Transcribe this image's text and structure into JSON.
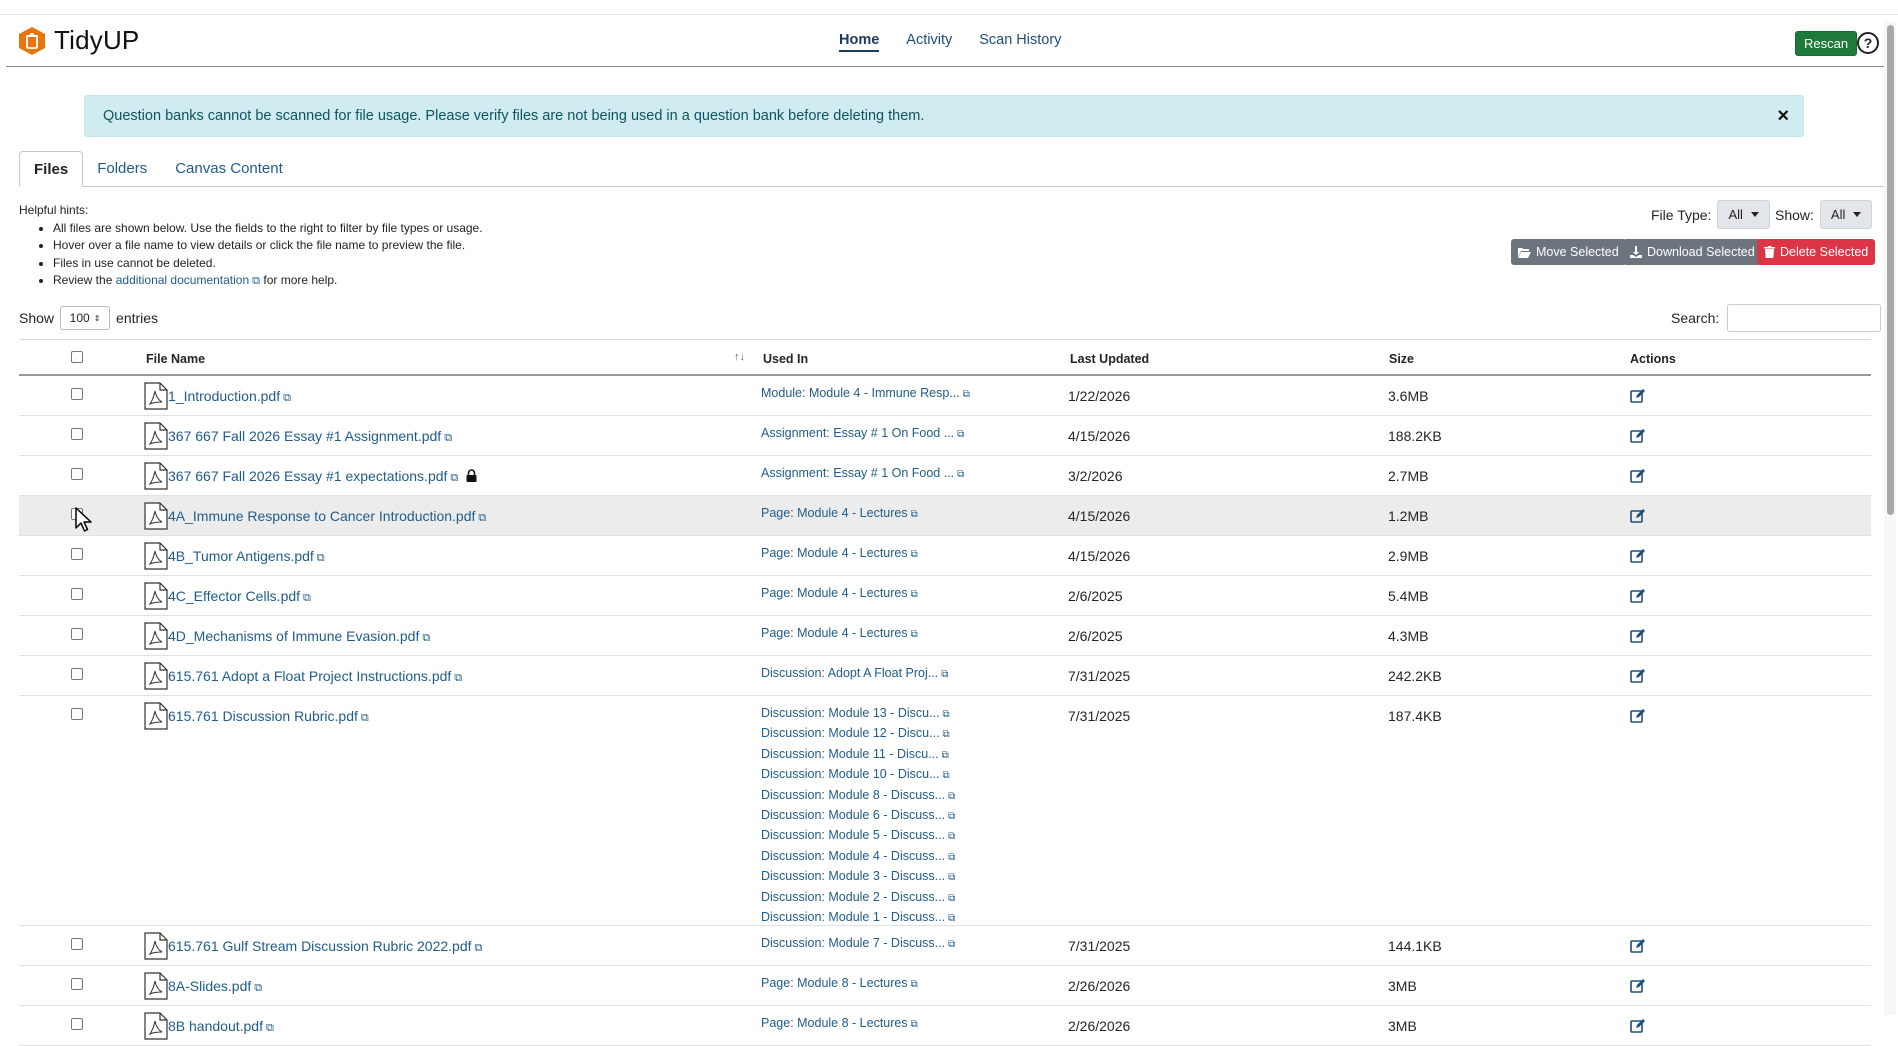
{
  "app": {
    "name": "TidyUP"
  },
  "nav": {
    "links": [
      "Home",
      "Activity",
      "Scan History"
    ],
    "active": "Home"
  },
  "header": {
    "rescan_label": "Rescan",
    "help_glyph": "?"
  },
  "alert": {
    "message": "Question banks cannot be scanned for file usage. Please verify files are not being used in a question bank before deleting them.",
    "close_glyph": "×"
  },
  "tabs": [
    "Files",
    "Folders",
    "Canvas Content"
  ],
  "hints": {
    "title": "Helpful hints:",
    "items": [
      "All files are shown below. Use the fields to the right to filter by file types or usage.",
      "Hover over a file name to view details or click the file name to preview the file.",
      "Files in use cannot be deleted."
    ],
    "review_prefix": "Review the",
    "review_link": "additional documentation",
    "review_suffix": "for more help."
  },
  "filters": {
    "file_type_label": "File Type:",
    "file_type_value": "All",
    "show_label": "Show:",
    "show_value": "All"
  },
  "actions": {
    "move": "Move Selected",
    "download": "Download Selected",
    "delete": "Delete Selected"
  },
  "entries": {
    "show_label": "Show",
    "value": "100",
    "suffix": "entries"
  },
  "search": {
    "label": "Search:",
    "value": ""
  },
  "table": {
    "headers": [
      "File Name",
      "Used In",
      "Last Updated",
      "Size",
      "Actions"
    ],
    "sort_glyph": "↑↓",
    "rows": [
      {
        "name": "1_Introduction.pdf",
        "used": [
          "Module: Module 4 - Immune Resp..."
        ],
        "date": "1/22/2026",
        "size": "3.6MB",
        "locked": false
      },
      {
        "name": "367 667 Fall 2026 Essay #1 Assignment.pdf",
        "used": [
          "Assignment: Essay # 1 On Food ..."
        ],
        "date": "4/15/2026",
        "size": "188.2KB",
        "locked": false
      },
      {
        "name": "367 667 Fall 2026 Essay #1 expectations.pdf",
        "used": [
          "Assignment: Essay # 1 On Food ..."
        ],
        "date": "3/2/2026",
        "size": "2.7MB",
        "locked": true
      },
      {
        "name": "4A_Immune Response to Cancer Introduction.pdf",
        "used": [
          "Page: Module 4 - Lectures"
        ],
        "date": "4/15/2026",
        "size": "1.2MB",
        "locked": false
      },
      {
        "name": "4B_Tumor Antigens.pdf",
        "used": [
          "Page: Module 4 - Lectures"
        ],
        "date": "4/15/2026",
        "size": "2.9MB",
        "locked": false
      },
      {
        "name": "4C_Effector Cells.pdf",
        "used": [
          "Page: Module 4 - Lectures"
        ],
        "date": "2/6/2025",
        "size": "5.4MB",
        "locked": false
      },
      {
        "name": "4D_Mechanisms of Immune Evasion.pdf",
        "used": [
          "Page: Module 4 - Lectures"
        ],
        "date": "2/6/2025",
        "size": "4.3MB",
        "locked": false
      },
      {
        "name": "615.761 Adopt a Float Project Instructions.pdf",
        "used": [
          "Discussion: Adopt A Float Proj..."
        ],
        "date": "7/31/2025",
        "size": "242.2KB",
        "locked": false
      },
      {
        "name": "615.761 Discussion Rubric.pdf",
        "used": [
          "Discussion: Module 13 - Discu...",
          "Discussion: Module 12 - Discu...",
          "Discussion: Module 11 - Discu...",
          "Discussion: Module 10 - Discu...",
          "Discussion: Module 8 - Discuss...",
          "Discussion: Module 6 - Discuss...",
          "Discussion: Module 5 - Discuss...",
          "Discussion: Module 4 - Discuss...",
          "Discussion: Module 3 - Discuss...",
          "Discussion: Module 2 - Discuss...",
          "Discussion: Module 1 - Discuss..."
        ],
        "date": "7/31/2025",
        "size": "187.4KB",
        "locked": false
      },
      {
        "name": "615.761 Gulf Stream Discussion Rubric 2022.pdf",
        "used": [
          "Discussion: Module 7 - Discuss..."
        ],
        "date": "7/31/2025",
        "size": "144.1KB",
        "locked": false
      },
      {
        "name": "8A-Slides.pdf",
        "used": [
          "Page: Module 8 - Lectures"
        ],
        "date": "2/26/2026",
        "size": "3MB",
        "locked": false
      },
      {
        "name": "8B handout.pdf",
        "used": [
          "Page: Module 8 - Lectures"
        ],
        "date": "2/26/2026",
        "size": "3MB",
        "locked": false
      }
    ]
  },
  "colors": {
    "link": "#1f5c8b",
    "rescan": "#1e7a3a",
    "delete": "#dc3545",
    "alert_bg": "#d1ecf1",
    "brand_orange": "#e8740c"
  }
}
